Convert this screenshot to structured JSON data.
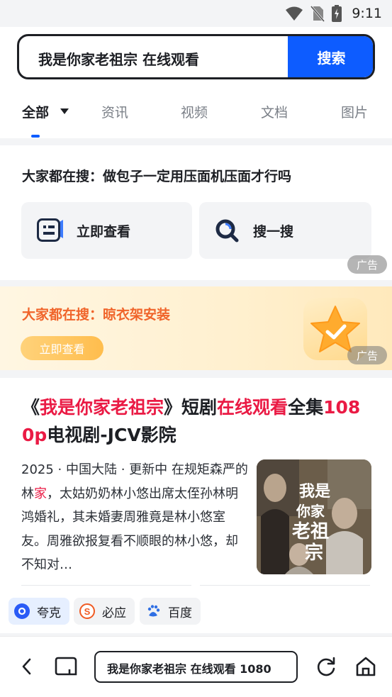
{
  "status": {
    "time": "9:11"
  },
  "search": {
    "query": "我是你家老祖宗 在线观看",
    "button": "搜索"
  },
  "tabs": [
    {
      "label": "全部",
      "active": true
    },
    {
      "label": "资讯"
    },
    {
      "label": "视频"
    },
    {
      "label": "文档"
    },
    {
      "label": "图片"
    }
  ],
  "card1": {
    "title": "大家都在搜：做包子一定用压面机压面才行吗",
    "btn_view": "立即查看",
    "btn_search": "搜一搜",
    "ad": "广告"
  },
  "banner": {
    "title": "大家都在搜：晾衣架安装",
    "button": "立即查看",
    "ad": "广告"
  },
  "result": {
    "title_p1": "《",
    "title_p2": "我是你家老祖宗",
    "title_p3": "》短剧",
    "title_p4": "在线观看",
    "title_p5": "全集",
    "title_p6": "1080p",
    "title_p7": "电视剧-JCV影院",
    "desc_p1": "2025 · 中国大陆 · 更新中 在规矩森严的林",
    "desc_p2": "家",
    "desc_p3": "，太姑奶奶林小悠出席太侄孙林明鸿婚礼，其未婚妻周雅竟是林小悠室友。周雅欲报复看不顺眼的林小悠，却不知对…",
    "thumb_text": "我是你家老祖宗"
  },
  "engines": [
    {
      "label": "夸克",
      "color": "#2a5bf6",
      "active": true
    },
    {
      "label": "必应",
      "color": "#f05a22"
    },
    {
      "label": "百度",
      "color": "#2f6fe4"
    }
  ],
  "bottom": {
    "url": "我是你家老祖宗 在线观看 1080"
  }
}
